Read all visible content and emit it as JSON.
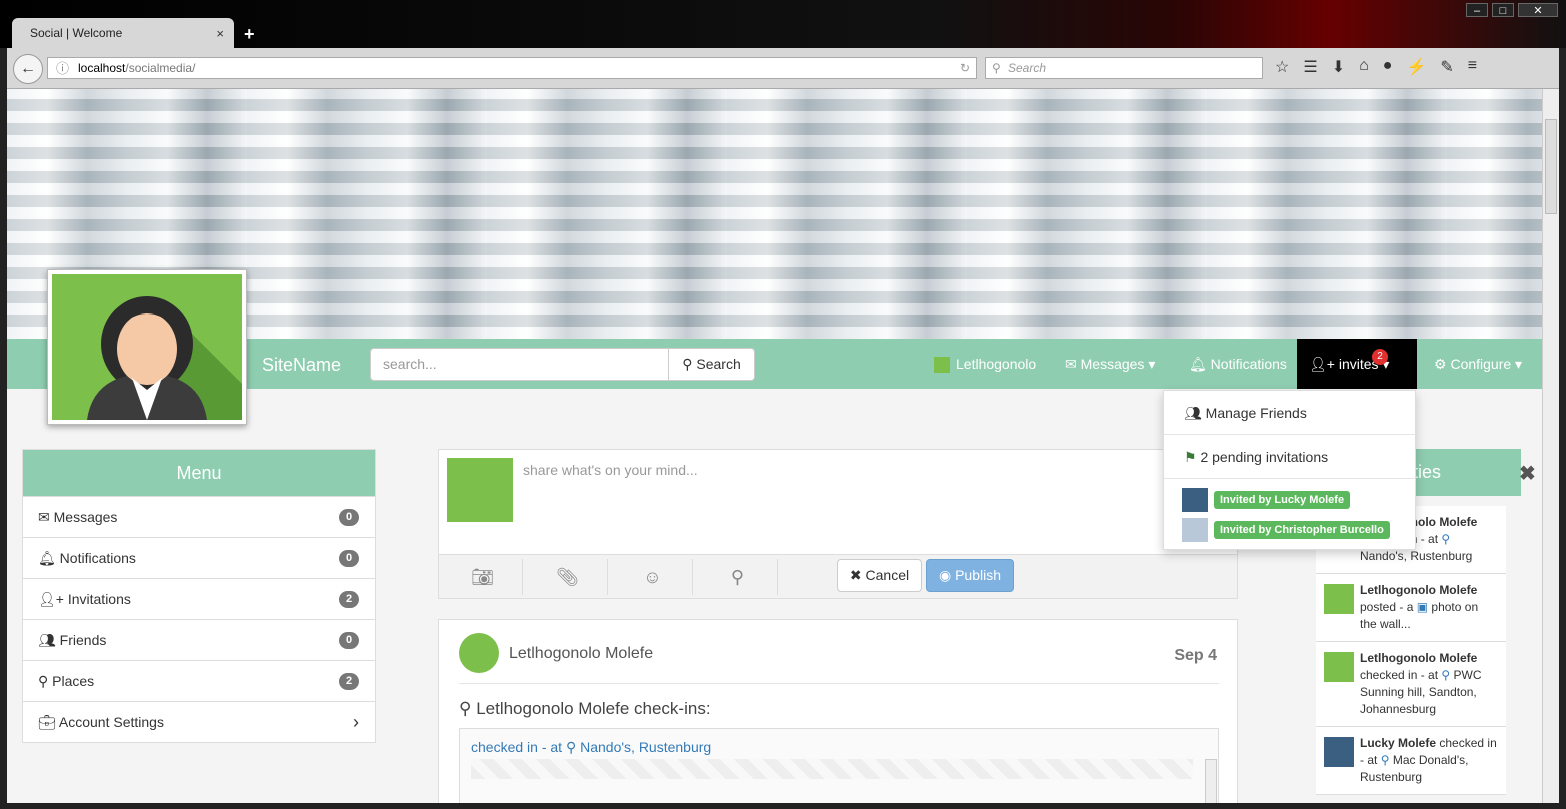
{
  "browser": {
    "tab_title": "Social | Welcome",
    "tab_close": "×",
    "new_tab": "+",
    "url_host": "localhost",
    "url_path": "/socialmedia/",
    "search_placeholder": "Search"
  },
  "site": {
    "name": "SiteName",
    "search_placeholder": "search...",
    "search_button": "Search",
    "nav": {
      "user": "Letlhogonolo",
      "messages": "Messages",
      "notifications": "Notifications",
      "invites": "invites",
      "invites_count": "2",
      "configure": "Configure"
    }
  },
  "invites_dropdown": {
    "manage": "Manage Friends",
    "pending": "2 pending invitations",
    "invites": [
      "Invited by Lucky Molefe",
      "Invited by Christopher Burcello"
    ]
  },
  "menu": {
    "title": "Menu",
    "items": [
      {
        "label": "Messages",
        "count": "0"
      },
      {
        "label": "Notifications",
        "count": "0"
      },
      {
        "label": "Invitations",
        "count": "2"
      },
      {
        "label": "Friends",
        "count": "0"
      },
      {
        "label": "Places",
        "count": "2"
      },
      {
        "label": "Account Settings",
        "count": ""
      }
    ]
  },
  "composer": {
    "placeholder": "share what's on your mind...",
    "cancel": "Cancel",
    "publish": "Publish"
  },
  "post": {
    "author": "Letlhogonolo Molefe",
    "date": "Sep 4",
    "title": "Letlhogonolo Molefe check-ins:",
    "checkin_prefix": "checked in - at",
    "checkin_place": "Nando's, Rustenburg"
  },
  "activities": {
    "title": "Activities",
    "items": [
      {
        "name": "Letlhogonolo Molefe",
        "text": "checked in - at",
        "place": "Nando's, Rustenburg"
      },
      {
        "name": "Letlhogonolo Molefe",
        "text": "posted - a",
        "place": "photo on the wall..."
      },
      {
        "name": "Letlhogonolo Molefe",
        "text": "checked in - at",
        "place": "PWC Sunning hill, Sandton, Johannesburg"
      },
      {
        "name": "Lucky Molefe",
        "text": "checked in - at",
        "place": "Mac Donald's, Rustenburg"
      }
    ]
  },
  "colors": {
    "accent": "#8fcdb0",
    "primary_light": "#7fb2e0",
    "badge_red": "#e03030",
    "label_green": "#5cb85c"
  }
}
